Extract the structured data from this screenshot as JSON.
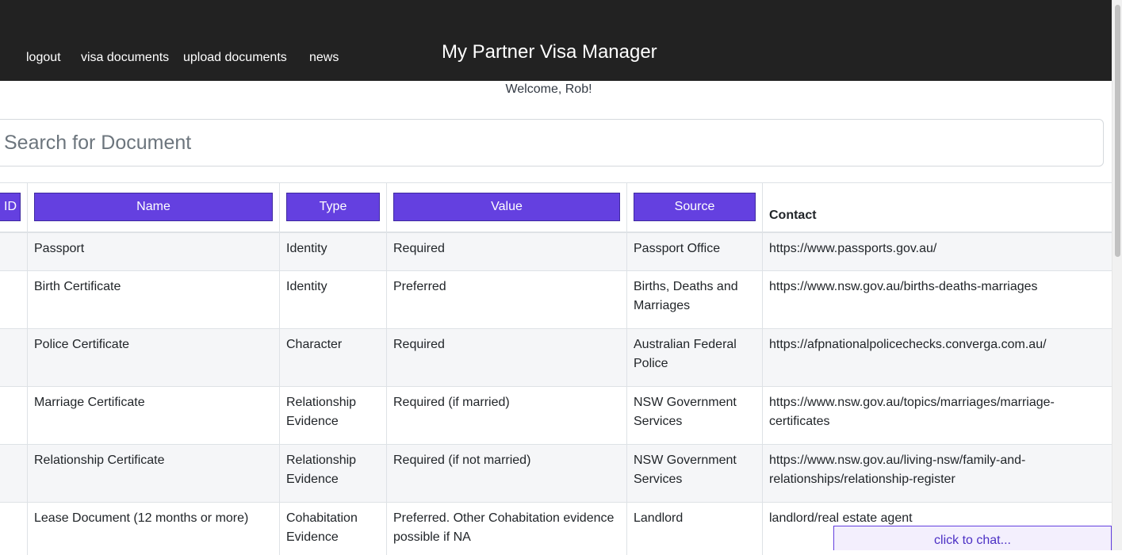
{
  "nav": {
    "logout": "logout",
    "visa_documents": "visa documents",
    "upload_documents": "upload documents",
    "news": "news"
  },
  "app_title": "My Partner Visa Manager",
  "welcome": "Welcome, Rob!",
  "search": {
    "placeholder": "Search for Document",
    "value": ""
  },
  "table": {
    "headers": {
      "id": "ID",
      "name": "Name",
      "type": "Type",
      "value": "Value",
      "source": "Source",
      "contact": "Contact"
    },
    "rows": [
      {
        "id": "",
        "name": "Passport",
        "type": "Identity",
        "value": "Required",
        "source": "Passport Office",
        "contact": "https://www.passports.gov.au/"
      },
      {
        "id": "",
        "name": "Birth Certificate",
        "type": "Identity",
        "value": "Preferred",
        "source": "Births, Deaths and Marriages",
        "contact": "https://www.nsw.gov.au/births-deaths-marriages"
      },
      {
        "id": "",
        "name": "Police Certificate",
        "type": "Character",
        "value": "Required",
        "source": "Australian Federal Police",
        "contact": "https://afpnationalpolicechecks.converga.com.au/"
      },
      {
        "id": "",
        "name": "Marriage Certificate",
        "type": "Relationship Evidence",
        "value": "Required (if married)",
        "source": "NSW Government Services",
        "contact": "https://www.nsw.gov.au/topics/marriages/marriage-certificates"
      },
      {
        "id": "",
        "name": "Relationship Certificate",
        "type": "Relationship Evidence",
        "value": "Required (if not married)",
        "source": "NSW Government Services",
        "contact": "https://www.nsw.gov.au/living-nsw/family-and-relationships/relationship-register"
      },
      {
        "id": "",
        "name": "Lease Document (12 months or more)",
        "type": "Cohabitation Evidence",
        "value": "Preferred. Other Cohabitation evidence possible if NA",
        "source": "Landlord",
        "contact": "landlord/real estate agent"
      }
    ]
  },
  "chat": {
    "label": "click to chat..."
  },
  "colors": {
    "header_bg": "#222222",
    "accent": "#6440e0",
    "row_stripe": "#f5f6f8"
  }
}
